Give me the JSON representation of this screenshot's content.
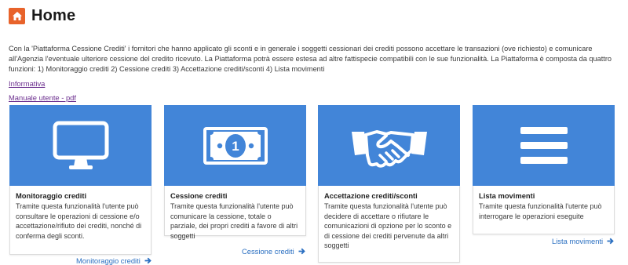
{
  "header": {
    "title": "Home",
    "icon": "home-icon",
    "accent": "#e8632b"
  },
  "intro_text": "Con la 'Piattaforma Cessione Crediti' i fornitori che hanno applicato gli sconti e in generale i soggetti cessionari dei crediti possono accettare le transazioni (ove richiesto) e comunicare all'Agenzia l'eventuale ulteriore cessione del credito ricevuto. La Piattaforma potrà essere estesa ad altre fattispecie compatibili con le sue funzionalità. La Piattaforma è composta da quattro funzioni: 1) Monitoraggio crediti 2) Cessione crediti 3) Accettazione crediti/sconti 4) Lista movimenti",
  "links": {
    "informativa": "Informativa",
    "manuale": "Manuale utente - pdf"
  },
  "colors": {
    "banner": "#4285d8",
    "link": "#2a6fc1",
    "visited_link": "#6b2e8e"
  },
  "cards": [
    {
      "icon": "monitor-icon",
      "title": "Monitoraggio crediti",
      "text": "Tramite questa funzionalità l'utente può consultare le operazioni di cessione e/o accettazione/rifiuto dei crediti, nonché di conferma degli sconti.",
      "link": "Monitoraggio crediti"
    },
    {
      "icon": "banknote-icon",
      "title": "Cessione crediti",
      "text": "Tramite questa funzionalità l'utente può comunicare la cessione, totale o parziale, dei propri crediti a favore di altri soggetti",
      "link": "Cessione crediti"
    },
    {
      "icon": "handshake-icon",
      "title": "Accettazione crediti/sconti",
      "text": "Tramite questa funzionalità l'utente può decidere di accettare o rifiutare le comunicazioni di opzione per lo sconto e di cessione dei crediti pervenute da altri soggetti",
      "link": ""
    },
    {
      "icon": "list-icon",
      "title": "Lista movimenti",
      "text": "Tramite questa funzionalità l'utente può interrogare le operazioni eseguite",
      "link": "Lista movimenti"
    }
  ]
}
